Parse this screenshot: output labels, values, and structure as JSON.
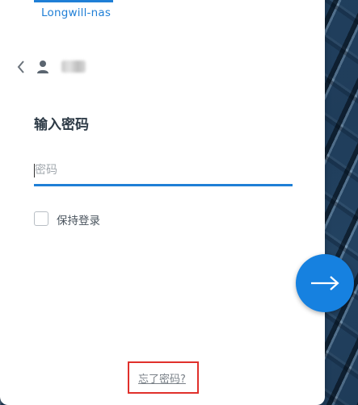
{
  "header": {
    "server_name": "Longwill-nas"
  },
  "account": {
    "back_icon": "chevron-left-icon",
    "user_icon": "user-icon"
  },
  "login": {
    "heading": "输入密码",
    "password_placeholder": "密码",
    "password_value": "",
    "remember_label": "保持登录",
    "remember_checked": false,
    "next_icon": "arrow-right-icon",
    "forgot_link": "忘了密码?"
  },
  "colors": {
    "accent": "#1f7fd6",
    "button": "#1681e0",
    "highlight_box": "#e0302b"
  }
}
